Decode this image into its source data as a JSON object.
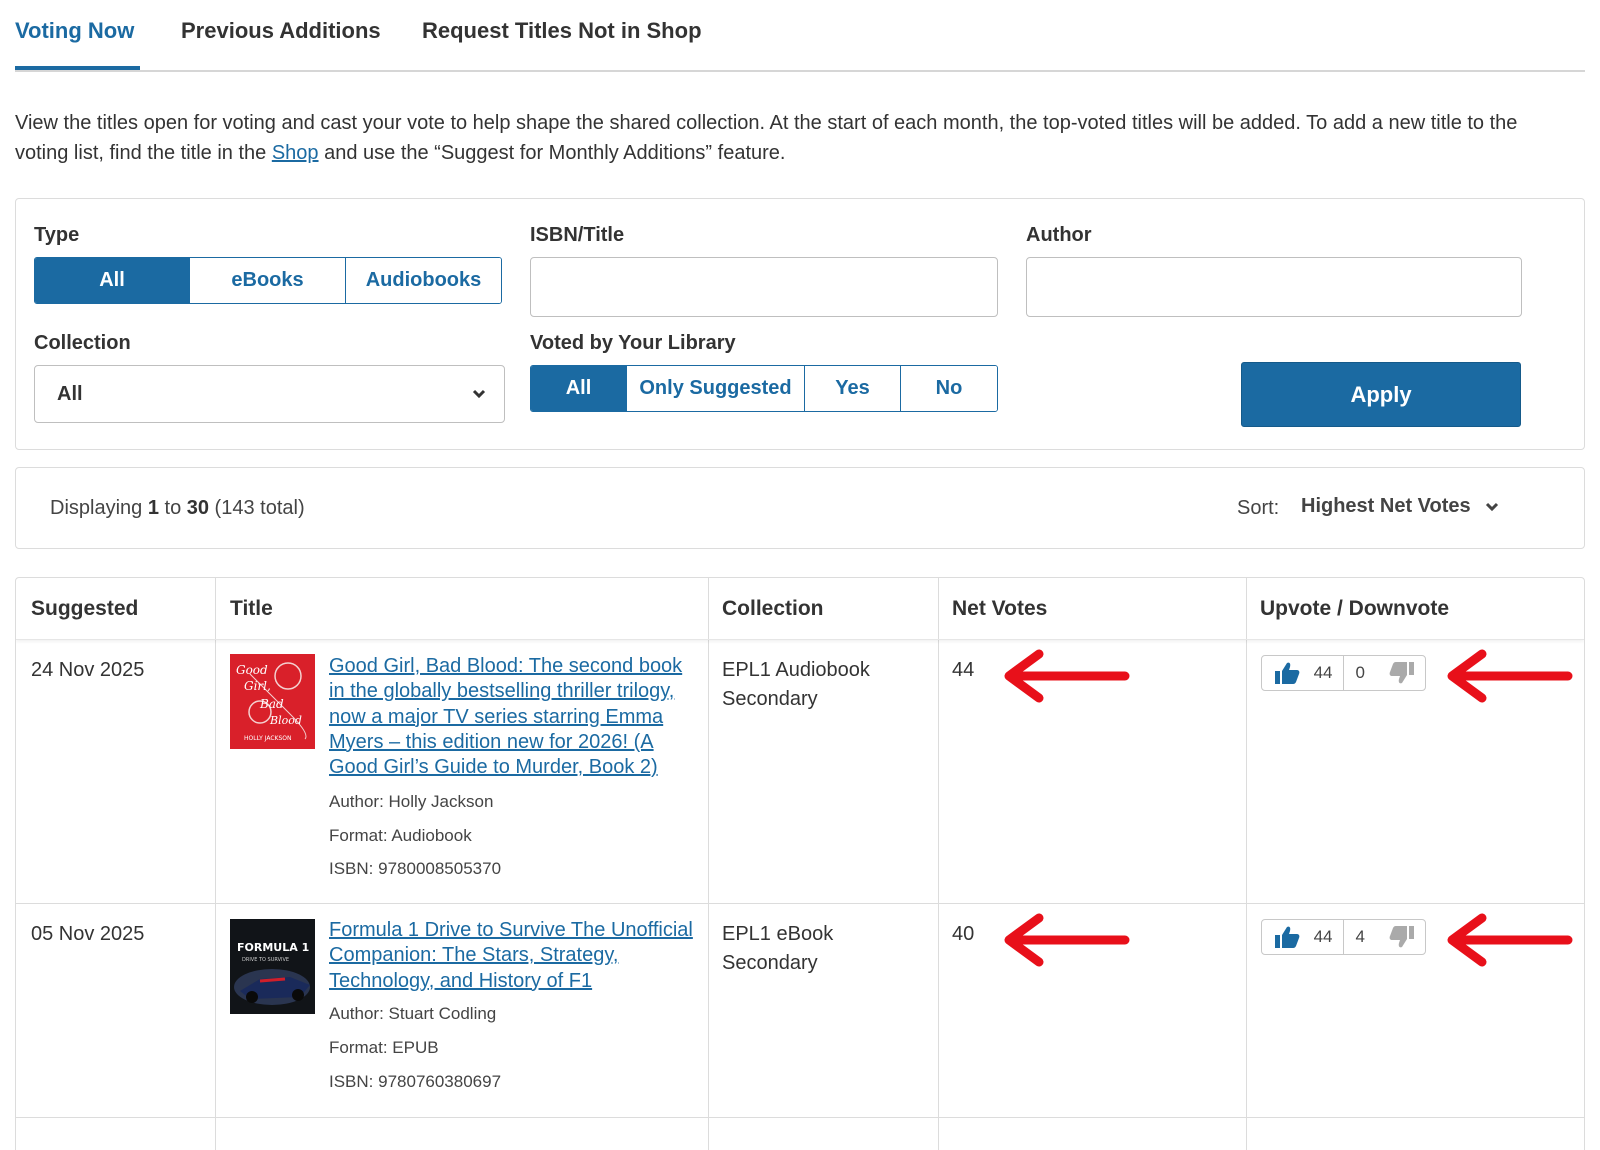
{
  "tabs": [
    {
      "label": "Voting Now",
      "active": true
    },
    {
      "label": "Previous Additions",
      "active": false
    },
    {
      "label": "Request Titles Not in Shop",
      "active": false
    }
  ],
  "intro": {
    "text_before": "View the titles open for voting and cast your vote to help shape the shared collection. At the start of each month, the top-voted titles will be added. To add a new title to the voting list, find the title in the ",
    "link": "Shop",
    "text_after": " and use the “Suggest for Monthly Additions” feature."
  },
  "filters": {
    "type_label": "Type",
    "type_options": [
      "All",
      "eBooks",
      "Audiobooks"
    ],
    "type_selected": "All",
    "isbn_label": "ISBN/Title",
    "isbn_value": "",
    "author_label": "Author",
    "author_value": "",
    "collection_label": "Collection",
    "collection_value": "All",
    "voted_label": "Voted by Your Library",
    "voted_options": [
      "All",
      "Only Suggested",
      "Yes",
      "No"
    ],
    "voted_selected": "All",
    "apply_label": "Apply"
  },
  "results": {
    "prefix": "Displaying ",
    "from": "1",
    "to_word": " to ",
    "to": "30",
    "total": " (143 total)",
    "sort_label": "Sort:",
    "sort_value": "Highest Net Votes"
  },
  "table": {
    "headers": [
      "Suggested",
      "Title",
      "Collection",
      "Net Votes",
      "Upvote / Downvote"
    ],
    "rows": [
      {
        "suggested": "24 Nov 2025",
        "title": "Good Girl, Bad Blood: The second book in the globally bestselling thriller trilogy, now a major TV series starring Emma Myers – this edition new for 2026! (A Good Girl’s Guide to Murder, Book 2)",
        "author": "Author: Holly Jackson",
        "format": "Format: Audiobook",
        "isbn": "ISBN: 9780008505370",
        "collection": "EPL1 Audiobook Secondary",
        "net_votes": "44",
        "upvotes": "44",
        "downvotes": "0",
        "cover_text": "Good Girl, Bad Blood",
        "cover_author": "HOLLY JACKSON"
      },
      {
        "suggested": "05 Nov 2025",
        "title": "Formula 1 Drive to Survive The Unofficial Companion: The Stars, Strategy, Technology, and History of F1",
        "author": "Author: Stuart Codling",
        "format": "Format: EPUB",
        "isbn": "ISBN: 9780760380697",
        "collection": "EPL1 eBook Secondary",
        "net_votes": "40",
        "upvotes": "44",
        "downvotes": "4",
        "cover_text": "FORMULA 1"
      }
    ]
  },
  "colors": {
    "accent": "#1b6aa2",
    "arrow": "#e8101a",
    "cover1": "#d9202a",
    "cover2": "#111418"
  },
  "icons": [
    "chevron-down-icon",
    "thumbs-up-icon",
    "thumbs-down-icon",
    "red-arrow-annotation"
  ]
}
